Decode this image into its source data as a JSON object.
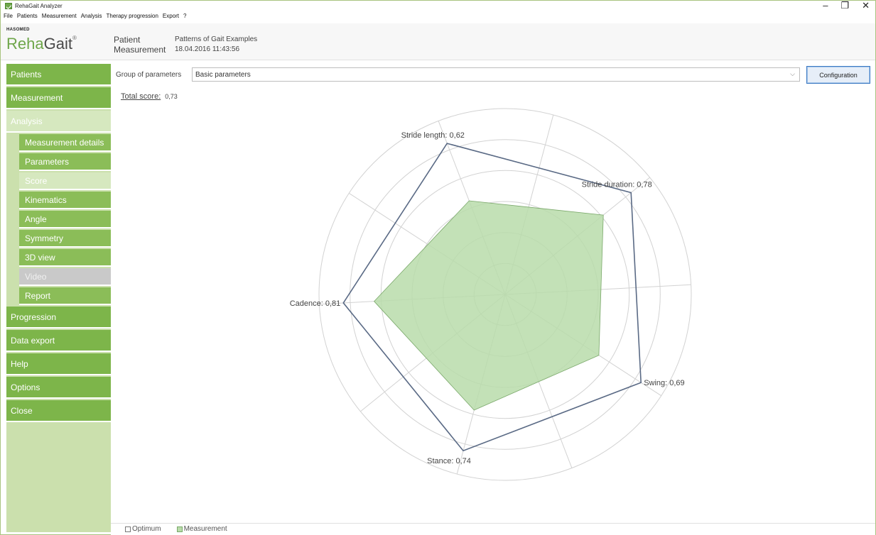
{
  "window": {
    "title": "RehaGait Analyzer",
    "controls": {
      "minimize": "–",
      "maximize": "❐",
      "close": "✕"
    }
  },
  "menu": [
    "File",
    "Patients",
    "Measurement",
    "Analysis",
    "Therapy progression",
    "Export",
    "?"
  ],
  "brand": {
    "company": "HASOMED",
    "product_part1": "Reha",
    "product_part2": "Gait",
    "registered": "®"
  },
  "header": {
    "patient_label": "Patient",
    "measurement_label": "Measurement",
    "patient_value": "Patterns of Gait Examples",
    "measurement_value": "18.04.2016 11:43:56"
  },
  "sidebar": {
    "items": [
      {
        "label": "Patients"
      },
      {
        "label": "Measurement"
      },
      {
        "label": "Analysis"
      },
      {
        "label": "Progression"
      },
      {
        "label": "Data export"
      },
      {
        "label": "Help"
      },
      {
        "label": "Options"
      },
      {
        "label": "Close"
      }
    ],
    "analysis_sub": [
      {
        "label": "Measurement details"
      },
      {
        "label": "Parameters"
      },
      {
        "label": "Score"
      },
      {
        "label": "Kinematics"
      },
      {
        "label": "Angle"
      },
      {
        "label": "Symmetry"
      },
      {
        "label": "3D view"
      },
      {
        "label": "Video"
      },
      {
        "label": "Report"
      }
    ]
  },
  "main": {
    "group_label": "Group of parameters",
    "group_value": "Basic parameters",
    "configuration_button": "Configuration",
    "total_score_label": "Total score:",
    "total_score_value": "0,73"
  },
  "chart_data": {
    "type": "radar",
    "axes": [
      {
        "name": "Stride length",
        "label": "Stride length: 0,62",
        "optimum": 1.0,
        "measurement": 0.62
      },
      {
        "name": "Stride duration",
        "label": "Stride duration: 0,78",
        "optimum": 1.0,
        "measurement": 0.78
      },
      {
        "name": "Swing",
        "label": "Swing: 0,69",
        "optimum": 1.0,
        "measurement": 0.69
      },
      {
        "name": "Stance",
        "label": "Stance: 0,74",
        "optimum": 1.0,
        "measurement": 0.74
      },
      {
        "name": "Cadence",
        "label": "Cadence: 0,81",
        "optimum": 1.0,
        "measurement": 0.81
      }
    ],
    "rings": 6,
    "legend": [
      {
        "name": "Optimum",
        "color": "#ffffff"
      },
      {
        "name": "Measurement",
        "color": "#b9dcaa"
      }
    ],
    "colors": {
      "optimum_line": "#5a6a85",
      "measurement_fill": "#b9dcaa",
      "measurement_stroke": "#7aa86a",
      "grid": "#d2d2d2"
    }
  },
  "colors": {
    "nav_green": "#7db54a",
    "sub_green": "#8bbd58",
    "selected_light": "#d6e8bf",
    "sidebar_bg": "#cbe0ad"
  }
}
